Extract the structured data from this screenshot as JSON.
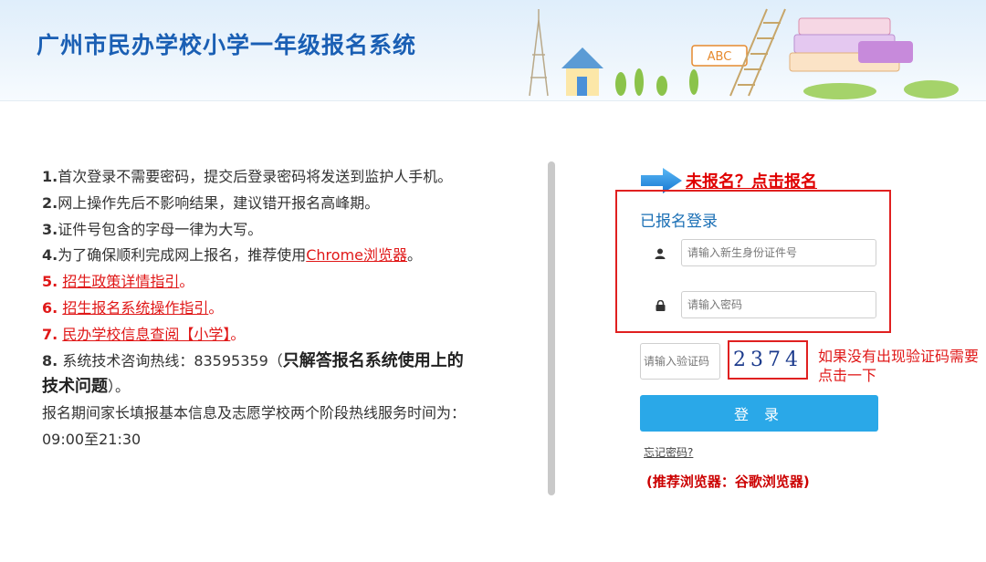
{
  "header": {
    "title": "广州市民办学校小学一年级报名系统",
    "sign_text": "ABC"
  },
  "notes": {
    "n1_num": "1.",
    "n1_text": "首次登录不需要密码，提交后登录密码将发送到监护人手机。",
    "n2_num": "2.",
    "n2_text": "网上操作先后不影响结果，建议错开报名高峰期。",
    "n3_num": "3.",
    "n3_text": "证件号包含的字母一律为大写。",
    "n4_num": "4.",
    "n4_text": "为了确保顺利完成网上报名，推荐使用",
    "n4_link": "Chrome浏览器",
    "n4_end": "。",
    "n5_num": "5.",
    "n5_link": "招生政策详情指引",
    "n5_end": "。",
    "n6_num": "6.",
    "n6_link": "招生报名系统操作指引",
    "n6_end": "。",
    "n7_num": "7.",
    "n7_link": "民办学校信息查阅【小学】",
    "n7_end": "。",
    "n8_num": "8.",
    "n8_text": "系统技术咨询热线：83595359（",
    "n8_bold": "只解答报名系统使用上的技术问题",
    "n8_end": "）。",
    "hotline_text": "报名期间家长填报基本信息及志愿学校两个阶段热线服务时间为：09:00至21:30"
  },
  "login": {
    "register_link": "未报名？点击报名",
    "title": "已报名登录",
    "id_placeholder": "请输入新生身份证件号",
    "password_placeholder": "请输入密码",
    "captcha_placeholder": "请输入验证码",
    "captcha_code": "2374",
    "captcha_hint": "如果没有出现验证码需要点击一下",
    "login_button": "登 录",
    "forgot_password": "忘记密码?",
    "browser_recommendation": "(推荐浏览器：谷歌浏览器)"
  },
  "icons": {
    "user": "user-icon",
    "lock": "lock-icon",
    "arrow": "arrow-right-icon"
  },
  "colors": {
    "title_blue": "#1a5fb4",
    "link_red": "#e01818",
    "button_blue": "#2aa8e8",
    "highlight_red_border": "#e02020"
  }
}
